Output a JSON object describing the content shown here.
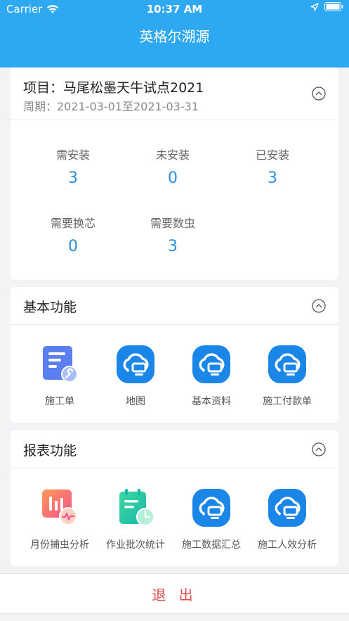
{
  "status_bar": {
    "carrier": "Carrier",
    "time": "10:37 AM"
  },
  "nav": {
    "title": "英格尔溯源"
  },
  "project": {
    "title": "项目：马尾松墨天牛试点2021",
    "period": "周期：2021-03-01至2021-03-31",
    "stats": [
      {
        "label": "需安装",
        "value": "3"
      },
      {
        "label": "未安装",
        "value": "0"
      },
      {
        "label": "已安装",
        "value": "3"
      },
      {
        "label": "需要换芯",
        "value": "0"
      },
      {
        "label": "需要数虫",
        "value": "3"
      }
    ]
  },
  "basic": {
    "title": "基本功能",
    "items": [
      {
        "label": "施工单",
        "icon": "work-order-icon"
      },
      {
        "label": "地图",
        "icon": "cloud-device-icon"
      },
      {
        "label": "基本资料",
        "icon": "cloud-device-icon"
      },
      {
        "label": "施工付款单",
        "icon": "cloud-device-icon"
      }
    ]
  },
  "report": {
    "title": "报表功能",
    "items": [
      {
        "label": "月份捕虫分析",
        "icon": "monthly-chart-icon"
      },
      {
        "label": "作业批次统计",
        "icon": "batch-clipboard-icon"
      },
      {
        "label": "施工数据汇总",
        "icon": "cloud-device-icon"
      },
      {
        "label": "施工人效分析",
        "icon": "cloud-device-icon"
      }
    ]
  },
  "logout": {
    "label": "退 出"
  },
  "colors": {
    "primary": "#2fa8f2",
    "value_blue": "#2b8fe0",
    "logout_red": "#e04b4b"
  }
}
